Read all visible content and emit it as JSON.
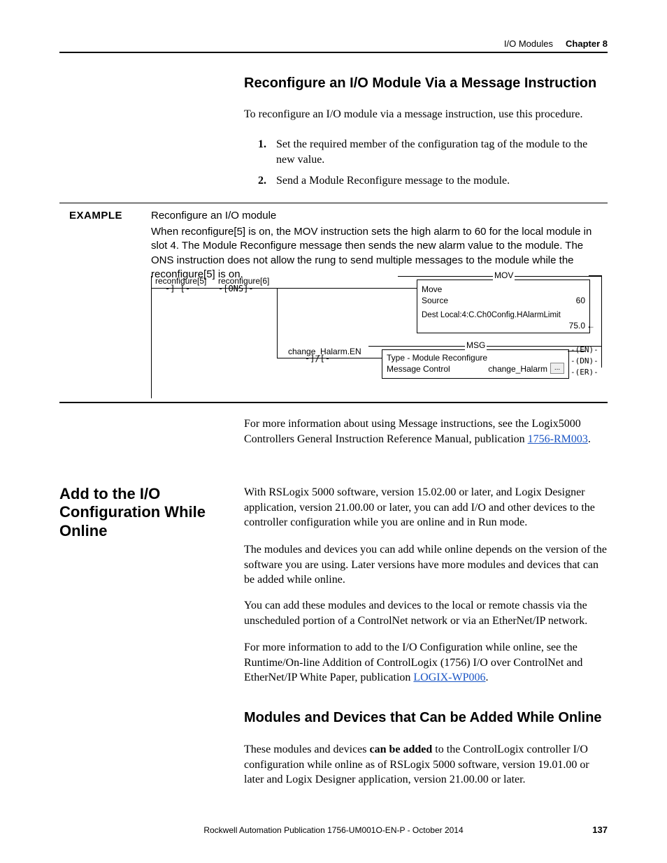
{
  "header": {
    "section": "I/O Modules",
    "chapter": "Chapter 8"
  },
  "h_reconfigure": "Reconfigure an I/O Module Via a Message Instruction",
  "p_reconfigure_intro": "To reconfigure an I/O module via a message instruction, use this procedure.",
  "step1_num": "1.",
  "step1": "Set the required member of the configuration tag of the module to the new value.",
  "step2_num": "2.",
  "step2": "Send a Module Reconfigure message to the module.",
  "example": {
    "label": "EXAMPLE",
    "title": "Reconfigure an I/O module",
    "body": "When reconfigure[5] is on, the MOV instruction sets the high alarm to 60 for the local module in slot 4. The Module Reconfigure message then sends the new alarm value to the module. The ONS instruction does not allow the rung to send multiple messages to the module while the reconfigure[5] is on."
  },
  "ladder": {
    "tag1": "reconfigure[5]",
    "tag2": "reconfigure[6]",
    "ons": "ONS",
    "mov": {
      "title": "MOV",
      "l1": "Move",
      "l2a": "Source",
      "l2b": "60",
      "l3": "Dest  Local:4:C.Ch0Config.HAlarmLimit",
      "l4": "75.0"
    },
    "branch_tag": "change_Halarm.EN",
    "msg": {
      "title": "MSG",
      "l1": "Type - Module Reconfigure",
      "l2a": "Message Control",
      "l2b": "change_Halarm",
      "btn": "...",
      "en": "EN",
      "dn": "DN",
      "er": "ER"
    }
  },
  "p_moreinfo_msg_a": "For more information about using Message instructions, see the Logix5000 Controllers General Instruction Reference Manual, publication ",
  "p_moreinfo_msg_link": "1756-RM003",
  "p_moreinfo_msg_b": ".",
  "h_addio": "Add to the I/O Configuration While Online",
  "p_addio_1": "With RSLogix 5000 software, version 15.02.00 or later, and Logix Designer application, version 21.00.00 or later, you can add I/O and other devices to the controller configuration while you are online and in Run mode.",
  "p_addio_2": "The modules and devices you can add while online depends on the version of the software you are using. Later versions have more modules and devices that can be added while online.",
  "p_addio_3": "You can add these modules and devices to the local or remote chassis via the unscheduled portion of a ControlNet network or via an EtherNet/IP network.",
  "p_addio_4a": "For more information to add to the I/O Configuration while online, see the Runtime/On-line Addition of ControlLogix (1756) I/O over ControlNet and EtherNet/IP White Paper, publication ",
  "p_addio_4link": "LOGIX-WP006",
  "p_addio_4b": ".",
  "h_modules_online": "Modules and Devices that Can be Added While Online",
  "p_modules_a": "These modules and devices ",
  "p_modules_bold": "can be added",
  "p_modules_b": " to the ControlLogix controller I/O configuration while online as of RSLogix 5000 software, version 19.01.00 or later and Logix Designer application, version 21.00.00 or later.",
  "footer": {
    "pub": "Rockwell Automation Publication 1756-UM001O-EN-P - October 2014",
    "page": "137"
  }
}
